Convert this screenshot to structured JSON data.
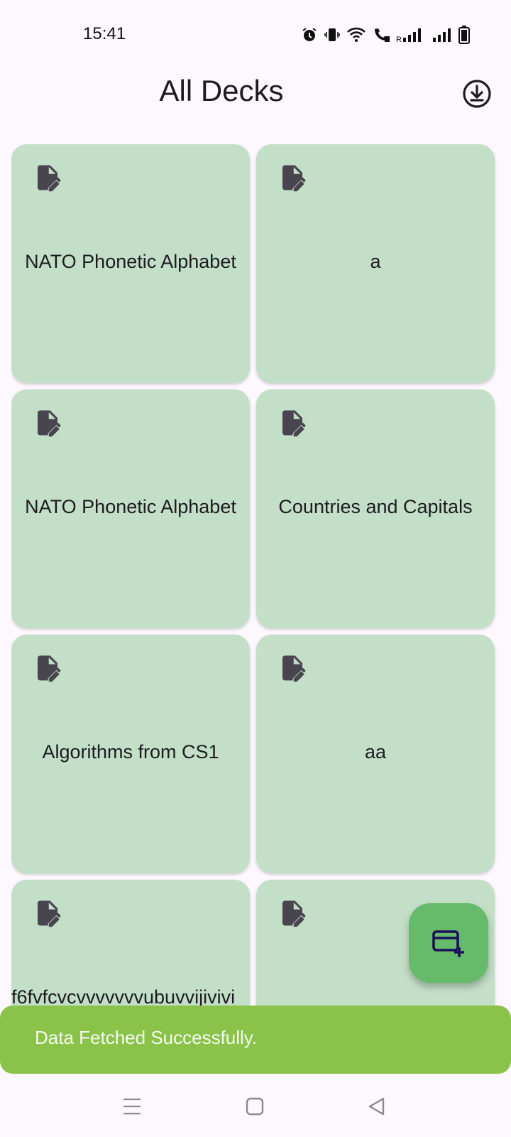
{
  "status_bar": {
    "time": "15:41",
    "icons": [
      "alarm-icon",
      "vibrate-icon",
      "wifi-icon",
      "wifi-calling-icon",
      "signal-roaming-icon",
      "signal-icon",
      "battery-icon"
    ]
  },
  "app_bar": {
    "title": "All Decks",
    "download_icon": "download-circle-icon"
  },
  "decks": [
    {
      "title": "NATO Phonetic Alphabet",
      "icon": "edit-note-icon"
    },
    {
      "title": "a",
      "icon": "edit-note-icon"
    },
    {
      "title": "NATO Phonetic Alphabet",
      "icon": "edit-note-icon"
    },
    {
      "title": "Countries and Capitals",
      "icon": "edit-note-icon"
    },
    {
      "title": "Algorithms from CS1",
      "icon": "edit-note-icon"
    },
    {
      "title": "aa",
      "icon": "edit-note-icon"
    },
    {
      "title": "f6fvfcvcvvvvvvvubuvvijivivi",
      "icon": "edit-note-icon"
    },
    {
      "title": "",
      "icon": "edit-note-icon"
    }
  ],
  "fab": {
    "icon": "add-card-icon"
  },
  "snackbar": {
    "message": "Data Fetched Successfully."
  },
  "nav_bar": {
    "icons": [
      "menu-icon",
      "home-square-icon",
      "back-triangle-icon"
    ]
  },
  "colors": {
    "background": "#fdf8fd",
    "card": "#c3dfc8",
    "fab": "#66bb6a",
    "snackbar": "#8bc34a",
    "icon": "#49454f"
  }
}
